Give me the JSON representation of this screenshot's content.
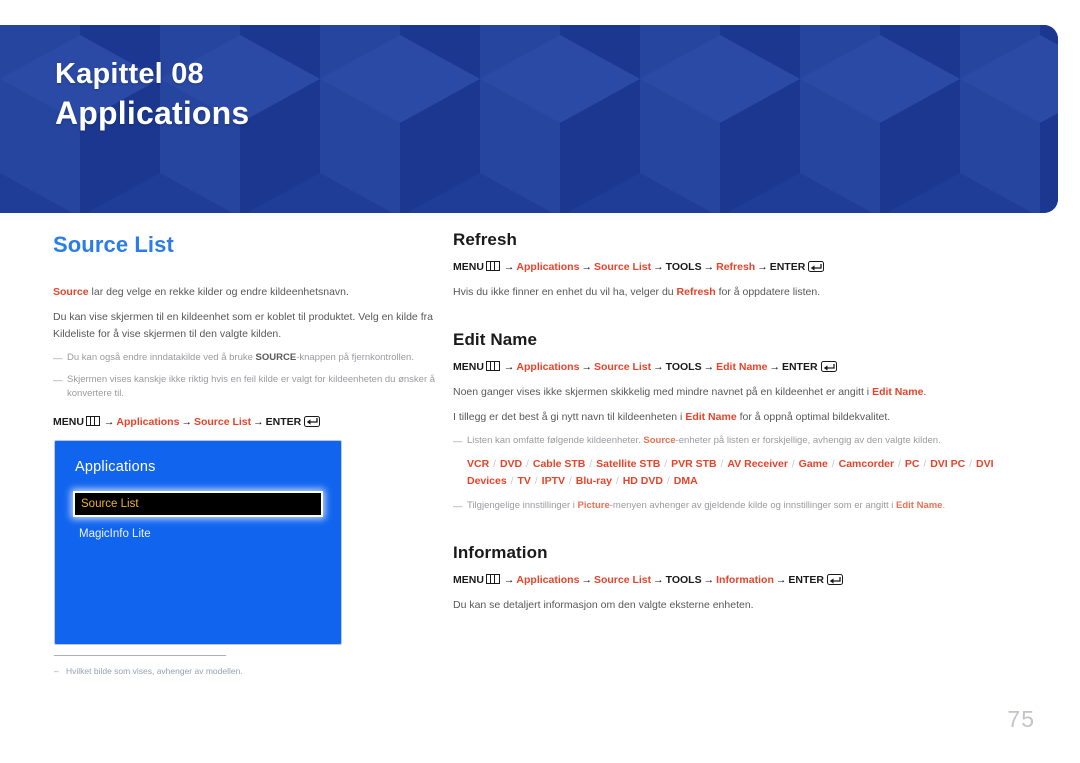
{
  "banner": {
    "chapter": "Kapittel 08",
    "title": "Applications",
    "bg_color": "#1f3d96"
  },
  "left_column": {
    "heading": "Source List",
    "heading_color": "#2b7de9",
    "paragraphs": [
      {
        "lead": "Source",
        "rest": " lar deg velge en rekke kilder og endre kildeenhetsnavn."
      },
      {
        "text": "Du kan vise skjermen til en kildeenhet som er koblet til produktet. Velg en kilde fra Kildeliste for å vise skjermen til den valgte kilden."
      }
    ],
    "notes": [
      {
        "pre": "Du kan også endre inndatakilde ved å bruke ",
        "bold": "SOURCE",
        "post": "-knappen på fjernkontrollen."
      },
      {
        "pre": "Skjermen vises kanskje ikke riktig hvis en feil kilde er valgt for kildeenheten du ønsker å konvertere til.",
        "bold": "",
        "post": ""
      }
    ],
    "path": {
      "menu": "MENU",
      "menu_icon": "menu-icon",
      "steps": [
        "Applications",
        "Source List"
      ],
      "enter": "ENTER",
      "enter_icon": "enter-icon"
    }
  },
  "tv_menu": {
    "title": "Applications",
    "items": [
      {
        "label": "Source List",
        "selected": true
      },
      {
        "label": "MagicInfo Lite",
        "selected": false
      }
    ],
    "bg_color": "#1164ee",
    "selected_text_color": "#f0b32a"
  },
  "footnote": {
    "dash": "–",
    "text": "Hvilket bilde som vises, avhenger av modellen."
  },
  "right_column": {
    "sections": [
      {
        "heading": "Refresh",
        "path": {
          "menu": "MENU",
          "steps_red": [
            "Applications",
            "Source List"
          ],
          "tools": "TOOLS",
          "target": "Refresh",
          "enter": "ENTER"
        },
        "body": {
          "pre": "Hvis du ikke finner en enhet du vil ha, velger du ",
          "accent": "Refresh",
          "post": " for å oppdatere listen."
        }
      },
      {
        "heading": "Edit Name",
        "path": {
          "menu": "MENU",
          "steps_red": [
            "Applications",
            "Source List"
          ],
          "tools": "TOOLS",
          "target": "Edit Name",
          "enter": "ENTER"
        },
        "body1": {
          "pre": "Noen ganger vises ikke skjermen skikkelig med mindre navnet på en kildeenhet er angitt i ",
          "accent": "Edit Name",
          "post": "."
        },
        "body2": {
          "pre": "I tillegg er det best å gi nytt navn til kildeenheten i ",
          "accent": "Edit Name",
          "post": " for å oppnå optimal bildekvalitet."
        },
        "note1": {
          "pre": "Listen kan omfatte følgende kildeenheter. ",
          "accent": "Source",
          "post": "-enheter på listen er forskjellige, avhengig av den valgte kilden."
        },
        "devices": [
          "VCR",
          "DVD",
          "Cable STB",
          "Satellite STB",
          "PVR STB",
          "AV Receiver",
          "Game",
          "Camcorder",
          "PC",
          "DVI PC",
          "DVI Devices",
          "TV",
          "IPTV",
          "Blu-ray",
          "HD DVD",
          "DMA"
        ],
        "note2": {
          "pre": "Tilgjengelige innstillinger i ",
          "accent1": "Picture",
          "mid": "-menyen avhenger av gjeldende kilde og innstillinger som er angitt i ",
          "accent2": "Edit Name",
          "post": "."
        }
      },
      {
        "heading": "Information",
        "path": {
          "menu": "MENU",
          "steps_red": [
            "Applications",
            "Source List"
          ],
          "tools": "TOOLS",
          "target": "Information",
          "enter": "ENTER"
        },
        "body": {
          "pre": "Du kan se detaljert informasjon om den valgte eksterne enheten.",
          "accent": "",
          "post": ""
        }
      }
    ]
  },
  "page_number": "75",
  "colors": {
    "accent_red": "#e8432a",
    "heading_blue": "#2b7de9",
    "body_gray": "#58585b",
    "note_gray": "#9a9aa0"
  }
}
